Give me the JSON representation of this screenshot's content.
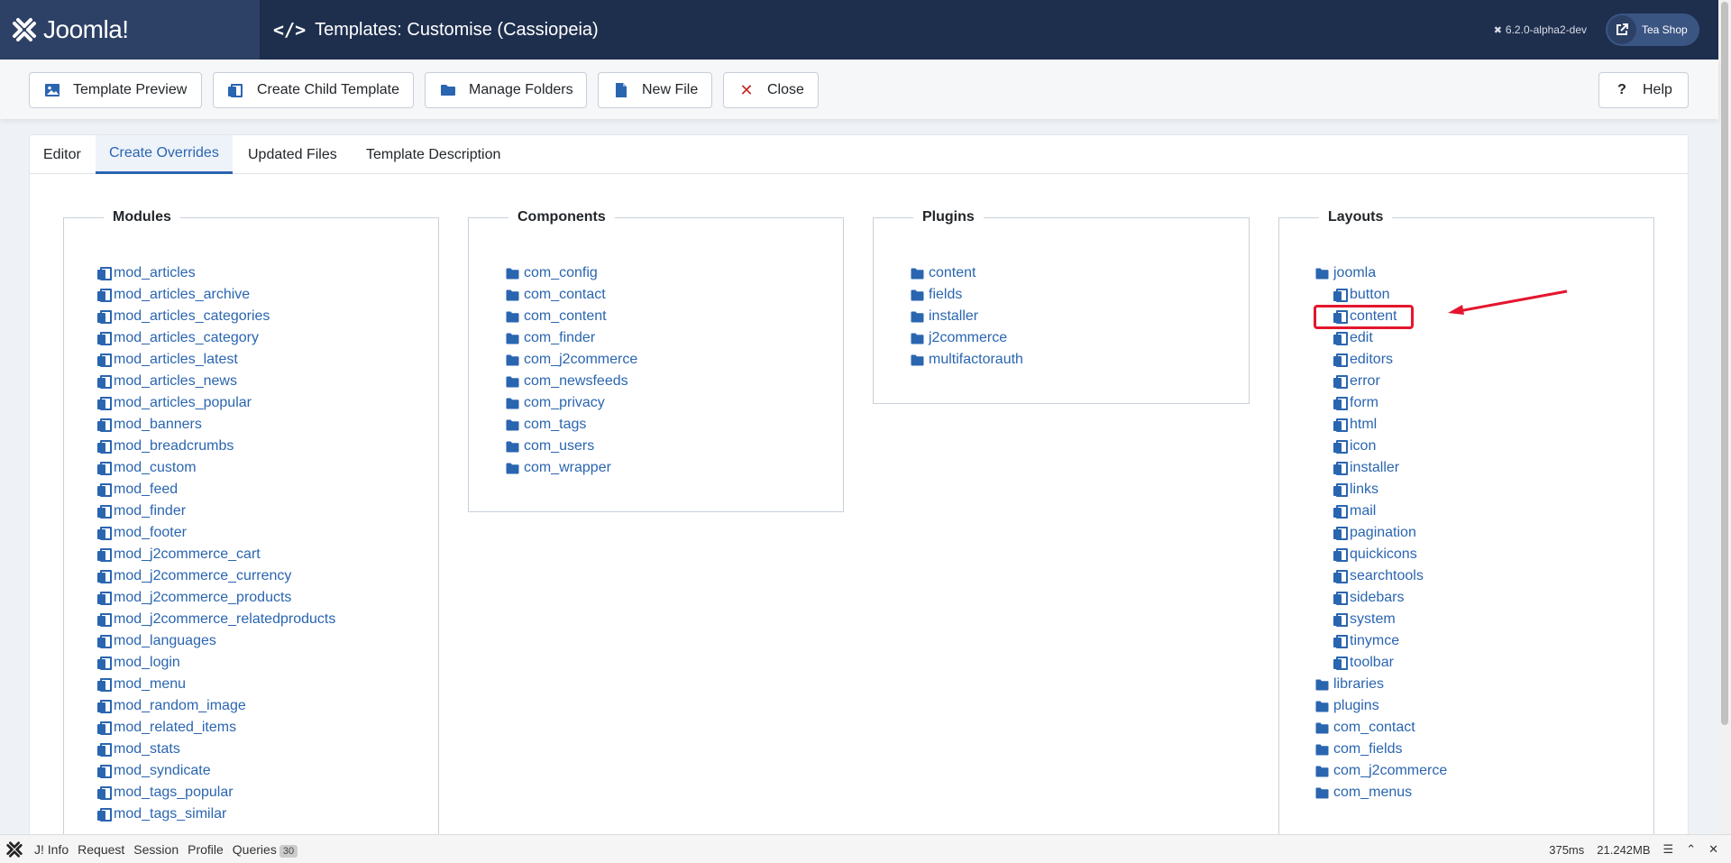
{
  "header": {
    "logo_text": "Joomla!",
    "page_title": "Templates: Customise (Cassiopeia)",
    "version": "6.2.0-alpha2-dev",
    "site_button": "Tea Shop"
  },
  "toolbar": {
    "template_preview": "Template Preview",
    "create_child": "Create Child Template",
    "manage_folders": "Manage Folders",
    "new_file": "New File",
    "close": "Close",
    "help": "Help"
  },
  "tabs": [
    "Editor",
    "Create Overrides",
    "Updated Files",
    "Template Description"
  ],
  "modules": {
    "title": "Modules",
    "items": [
      "mod_articles",
      "mod_articles_archive",
      "mod_articles_categories",
      "mod_articles_category",
      "mod_articles_latest",
      "mod_articles_news",
      "mod_articles_popular",
      "mod_banners",
      "mod_breadcrumbs",
      "mod_custom",
      "mod_feed",
      "mod_finder",
      "mod_footer",
      "mod_j2commerce_cart",
      "mod_j2commerce_currency",
      "mod_j2commerce_products",
      "mod_j2commerce_relatedproducts",
      "mod_languages",
      "mod_login",
      "mod_menu",
      "mod_random_image",
      "mod_related_items",
      "mod_stats",
      "mod_syndicate",
      "mod_tags_popular",
      "mod_tags_similar"
    ]
  },
  "components": {
    "title": "Components",
    "items": [
      "com_config",
      "com_contact",
      "com_content",
      "com_finder",
      "com_j2commerce",
      "com_newsfeeds",
      "com_privacy",
      "com_tags",
      "com_users",
      "com_wrapper"
    ]
  },
  "plugins": {
    "title": "Plugins",
    "items": [
      "content",
      "fields",
      "installer",
      "j2commerce",
      "multifactorauth"
    ]
  },
  "layouts": {
    "title": "Layouts",
    "root": "joomla",
    "children": [
      "button",
      "content",
      "edit",
      "editors",
      "error",
      "form",
      "html",
      "icon",
      "installer",
      "links",
      "mail",
      "pagination",
      "quickicons",
      "searchtools",
      "sidebars",
      "system",
      "tinymce",
      "toolbar"
    ],
    "folders": [
      "libraries",
      "plugins",
      "com_contact",
      "com_fields",
      "com_j2commerce",
      "com_menus"
    ]
  },
  "debugbar": {
    "info": "J! Info",
    "request": "Request",
    "session": "Session",
    "profile": "Profile",
    "queries": "Queries",
    "queries_count": "30",
    "time": "375ms",
    "memory": "21.242MB"
  },
  "colors": {
    "header_bg": "#1e2f4e",
    "link": "#2a65b0",
    "highlight": "#e4162e"
  }
}
